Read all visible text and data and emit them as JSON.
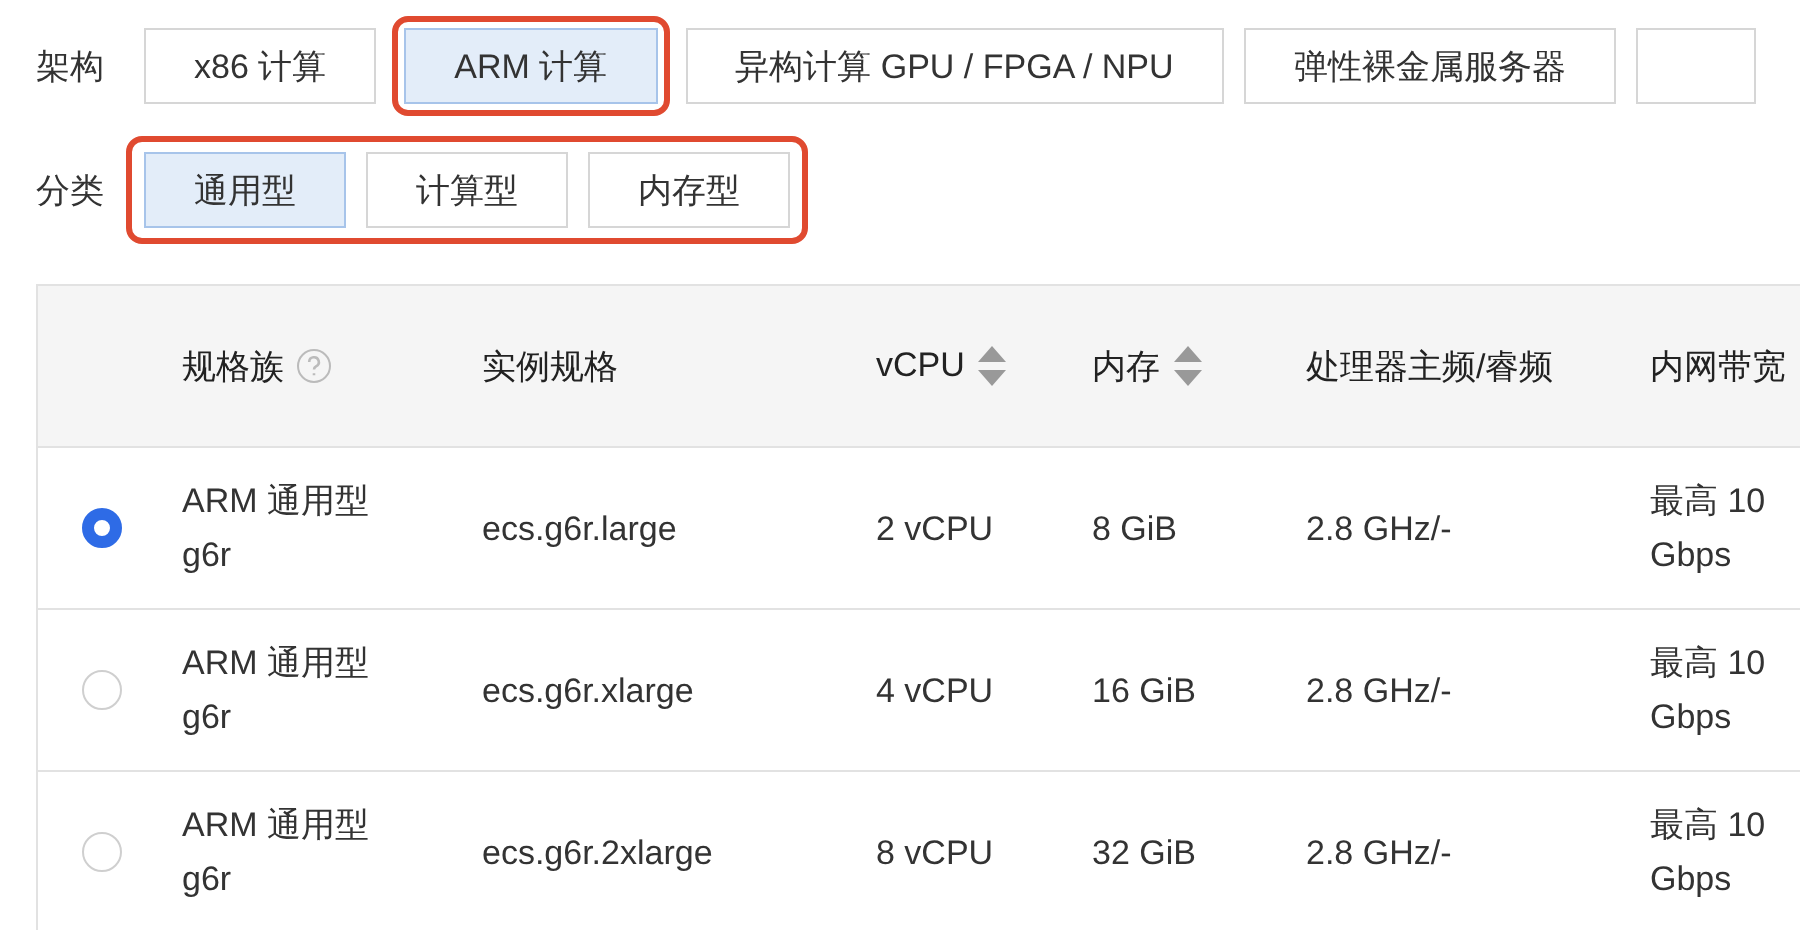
{
  "filters": [
    {
      "label": "架构",
      "highlighted": false,
      "options": [
        {
          "text": "x86 计算",
          "selected": false,
          "highlighted": false
        },
        {
          "text": "ARM 计算",
          "selected": true,
          "highlighted": true
        },
        {
          "text": "异构计算 GPU / FPGA / NPU",
          "selected": false,
          "highlighted": false
        },
        {
          "text": "弹性裸金属服务器",
          "selected": false,
          "highlighted": false
        },
        {
          "selected": false,
          "highlighted": false
        }
      ]
    },
    {
      "label": "分类",
      "highlighted": true,
      "options": [
        {
          "text": "通用型",
          "selected": true,
          "highlighted": false
        },
        {
          "text": "计算型",
          "selected": false,
          "highlighted": false
        },
        {
          "text": "内存型",
          "selected": false,
          "highlighted": false
        }
      ]
    }
  ],
  "table": {
    "columns": [
      {
        "label": "规格族",
        "kind": "help"
      },
      {
        "label": "实例规格",
        "kind": "plain"
      },
      {
        "label": "vCPU",
        "kind": "sort"
      },
      {
        "label": "内存",
        "kind": "sort"
      },
      {
        "label": "处理器主频/睿频",
        "kind": "plain"
      },
      {
        "label": "内网带宽",
        "kind": "plain"
      }
    ],
    "rows": [
      {
        "selected": true,
        "cells": [
          "ARM 通用型 g6r",
          "ecs.g6r.large",
          "2 vCPU",
          "8 GiB",
          "2.8 GHz/-",
          "最高 10 Gbps"
        ]
      },
      {
        "selected": false,
        "cells": [
          "ARM 通用型 g6r",
          "ecs.g6r.xlarge",
          "4 vCPU",
          "16 GiB",
          "2.8 GHz/-",
          "最高 10 Gbps"
        ]
      },
      {
        "selected": false,
        "cells": [
          "ARM 通用型 g6r",
          "ecs.g6r.2xlarge",
          "8 vCPU",
          "32 GiB",
          "2.8 GHz/-",
          "最高 10 Gbps"
        ]
      }
    ]
  }
}
